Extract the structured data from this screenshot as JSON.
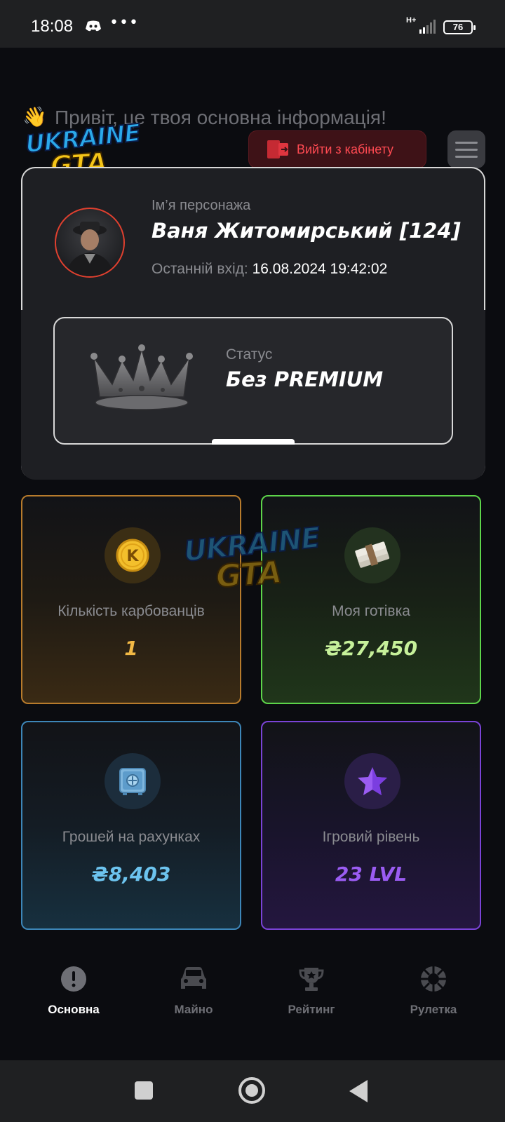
{
  "status_bar": {
    "time": "18:08",
    "network": "H+",
    "battery": "76"
  },
  "header": {
    "greeting": "Привіт, це твоя основна інформація!",
    "logo_word_1": "UKRAINE",
    "logo_word_2": "GTA",
    "logout_label": "Вийти з кабінету"
  },
  "profile": {
    "name_label": "Ім’я персонажа",
    "name_value": "Ваня Житомирський [124]",
    "last_login_label": "Останній вхід:",
    "last_login_value": "16.08.2024 19:42:02",
    "status_label": "Статус",
    "status_value": "Без PREMIUM"
  },
  "stats": [
    {
      "label": "Кількість карбованців",
      "value": "1",
      "icon": "karbovanets-coin-icon"
    },
    {
      "label": "Моя готівка",
      "value": "₴27,450",
      "icon": "cash-stack-icon"
    },
    {
      "label": "Грошей на рахунках",
      "value": "₴8,403",
      "icon": "safe-icon"
    },
    {
      "label": "Ігровий рівень",
      "value": "23 LVL",
      "icon": "star-icon"
    }
  ],
  "bottom_nav": [
    {
      "label": "Основна",
      "icon": "info-icon",
      "active": true
    },
    {
      "label": "Майно",
      "icon": "car-icon",
      "active": false
    },
    {
      "label": "Рейтинг",
      "icon": "trophy-icon",
      "active": false
    },
    {
      "label": "Рулетка",
      "icon": "roulette-icon",
      "active": false
    }
  ],
  "colors": {
    "karbovanets": "#f1b845",
    "cash": "#c6f09a",
    "bank": "#6cc3ee",
    "level": "#9a5cf2",
    "logout": "#ff4a52"
  }
}
